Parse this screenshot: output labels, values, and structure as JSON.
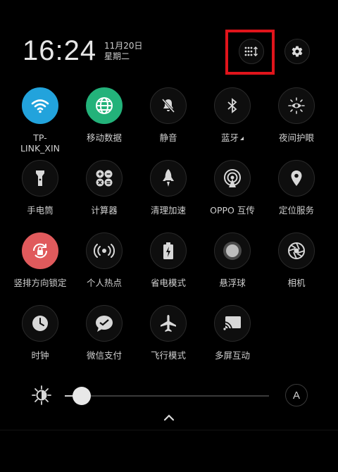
{
  "header": {
    "time": "16:24",
    "date": "11月20日",
    "weekday": "星期二"
  },
  "tiles": [
    {
      "label": "TP-",
      "label2": "LINK_XIN",
      "icon": "wifi-icon",
      "state": "on",
      "color": "#22a3dc",
      "caret": true
    },
    {
      "label": "移动数据",
      "icon": "globe-icon",
      "state": "on",
      "color": "#23b27a"
    },
    {
      "label": "静音",
      "icon": "bell-muted-icon",
      "state": "off"
    },
    {
      "label": "蓝牙",
      "icon": "bluetooth-icon",
      "state": "off",
      "caret": true
    },
    {
      "label": "夜间护眼",
      "icon": "eye-sun-icon",
      "state": "off"
    },
    {
      "label": "手电筒",
      "icon": "flashlight-icon",
      "state": "off"
    },
    {
      "label": "计算器",
      "icon": "calculator-icon",
      "state": "off"
    },
    {
      "label": "清理加速",
      "icon": "rocket-icon",
      "state": "off"
    },
    {
      "label": "OPPO 互传",
      "icon": "share-signal-icon",
      "state": "off"
    },
    {
      "label": "定位服务",
      "icon": "location-pin-icon",
      "state": "off"
    },
    {
      "label": "竖排方向锁定",
      "icon": "rotation-lock-icon",
      "state": "on",
      "color": "#e05a5c"
    },
    {
      "label": "个人热点",
      "icon": "hotspot-icon",
      "state": "off"
    },
    {
      "label": "省电模式",
      "icon": "battery-saver-icon",
      "state": "off"
    },
    {
      "label": "悬浮球",
      "icon": "floating-ball-icon",
      "state": "off"
    },
    {
      "label": "相机",
      "icon": "camera-aperture-icon",
      "state": "off"
    },
    {
      "label": "时钟",
      "icon": "clock-icon",
      "state": "off"
    },
    {
      "label": "微信支付",
      "icon": "wechat-pay-icon",
      "state": "off"
    },
    {
      "label": "飞行模式",
      "icon": "airplane-icon",
      "state": "off"
    },
    {
      "label": "多屏互动",
      "icon": "cast-screen-icon",
      "state": "off"
    }
  ],
  "brightness": {
    "level": 0.08,
    "auto_label": "A"
  }
}
